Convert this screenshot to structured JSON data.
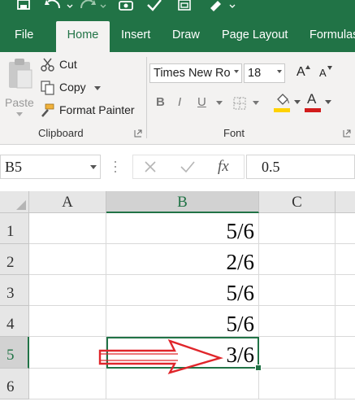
{
  "ribbon_tabs": [
    "File",
    "Home",
    "Insert",
    "Draw",
    "Page Layout",
    "Formulas"
  ],
  "clipboard": {
    "paste_label": "Paste",
    "cut_label": "Cut",
    "copy_label": "Copy",
    "format_painter_label": "Format Painter",
    "group_label": "Clipboard"
  },
  "font": {
    "family": "Times New Ro",
    "size": "18",
    "bold_label": "B",
    "italic_label": "I",
    "underline_label": "U",
    "grow_label": "A",
    "shrink_label": "A",
    "font_color_label": "A",
    "group_label": "Font"
  },
  "formula_bar": {
    "name_box": "B5",
    "fx_label": "fx",
    "value": "0.5"
  },
  "columns": [
    "A",
    "B",
    "C"
  ],
  "rows": [
    {
      "num": "1",
      "b": "5/6"
    },
    {
      "num": "2",
      "b": "2/6"
    },
    {
      "num": "3",
      "b": "5/6"
    },
    {
      "num": "4",
      "b": "5/6"
    },
    {
      "num": "5",
      "b": "3/6"
    },
    {
      "num": "6",
      "b": ""
    }
  ],
  "colors": {
    "excel_green": "#217346",
    "ribbon_bg": "#f3f2f1",
    "arrow_red": "#e0262b",
    "highlight_yellow": "#ffd200",
    "font_color_red": "#d21c1c"
  }
}
